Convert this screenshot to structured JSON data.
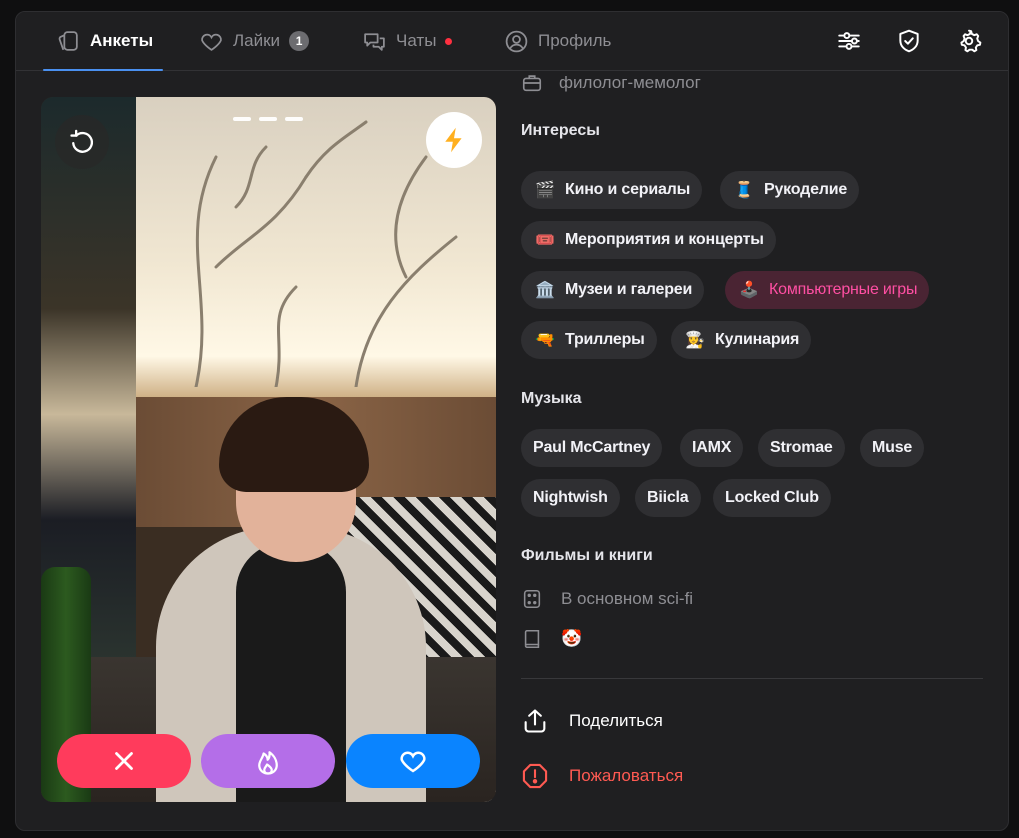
{
  "tabs": [
    {
      "label": "Анкеты"
    },
    {
      "label": "Лайки",
      "badge": "1"
    },
    {
      "label": "Чаты"
    },
    {
      "label": "Профиль"
    }
  ],
  "profile": {
    "job": "филолог-мемолог",
    "interests_title": "Интересы",
    "interests": [
      {
        "emoji": "🎬",
        "label": "Кино и сериалы"
      },
      {
        "emoji": "🧵",
        "label": "Рукоделие"
      },
      {
        "emoji": "🎟️",
        "label": "Мероприятия и концерты"
      },
      {
        "emoji": "🏛️",
        "label": "Музеи и галереи"
      },
      {
        "emoji": "🕹️",
        "label": "Компьютерные игры"
      },
      {
        "emoji": "🔫",
        "label": "Триллеры"
      },
      {
        "emoji": "👩‍🍳",
        "label": "Кулинария"
      }
    ],
    "music_title": "Музыка",
    "music": [
      "Paul McCartney",
      "IAMX",
      "Stromae",
      "Muse",
      "Nightwish",
      "Biicla",
      "Locked Club"
    ],
    "films_title": "Фильмы и книги",
    "films": "В основном sci-fi",
    "books": "🤡"
  },
  "actions": {
    "share": "Поделиться",
    "report": "Пожаловаться"
  },
  "colors": {
    "accent": "#4a90f0",
    "dislike": "#ff3b5c",
    "superlike": "#b46ee8",
    "like": "#0a84ff",
    "highlight_chip": "#ff4fa3",
    "report": "#ff5a52",
    "boost": "#ffb020"
  }
}
